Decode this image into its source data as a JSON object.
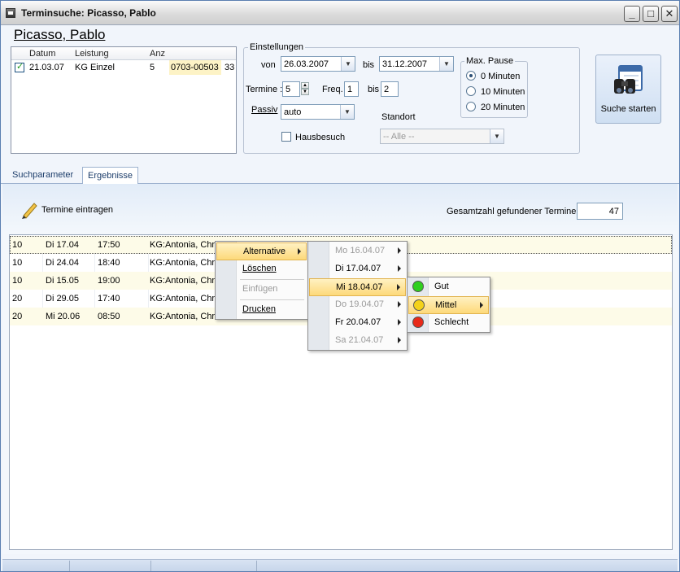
{
  "window": {
    "title": "Terminsuche: Picasso, Pablo"
  },
  "patient_name": "Picasso, Pablo",
  "booking": {
    "headers": [
      "Datum",
      "Leistung",
      "Anz"
    ],
    "rows": [
      {
        "checked": true,
        "datum": "21.03.07",
        "leistung": "KG Einzel",
        "anz": "5",
        "nummer": "0703-00503",
        "extra": "33"
      }
    ]
  },
  "settings": {
    "group_title": "Einstellungen",
    "von_label": "von",
    "von_value": "26.03.2007",
    "bis_label": "bis",
    "bis_value": "31.12.2007",
    "termine_label": "Termine :",
    "termine_value": "5",
    "freq_label": "Freq.",
    "freq_value": "1",
    "freq_bis_label": "bis",
    "freq_bis_value": "2",
    "passiv_label": "Passiv",
    "passiv_value": "auto",
    "standort_label": "Standort",
    "standort_value": "-- Alle --",
    "hausbesuch_label": "Hausbesuch",
    "hausbesuch_checked": false
  },
  "pause": {
    "title": "Max. Pause",
    "options": [
      "0 Minuten",
      "10 Minuten",
      "20 Minuten"
    ],
    "selected": "0 Minuten"
  },
  "search_button": {
    "label": "Suche starten"
  },
  "tabs": [
    {
      "label": "Suchparameter",
      "active": false
    },
    {
      "label": "Ergebnisse",
      "active": true
    }
  ],
  "toolbar": {
    "enter_label": "Termine eintragen",
    "total_label": "Gesamtzahl gefundener Termine",
    "total_value": "47"
  },
  "results": [
    {
      "col1": "10",
      "day": "Di 17.04",
      "time": "17:50",
      "desc": "KG:Antonia, Chri"
    },
    {
      "col1": "10",
      "day": "Di 24.04",
      "time": "18:40",
      "desc": "KG:Antonia, Chri"
    },
    {
      "col1": "10",
      "day": "Di 15.05",
      "time": "19:00",
      "desc": "KG:Antonia, Chri"
    },
    {
      "col1": "20",
      "day": "Di 29.05",
      "time": "17:40",
      "desc": "KG:Antonia, Chri"
    },
    {
      "col1": "20",
      "day": "Mi 20.06",
      "time": "08:50",
      "desc": "KG:Antonia, Chri"
    }
  ],
  "context_menu": {
    "items": [
      {
        "label": "Alternative",
        "enabled": true,
        "submenu": true,
        "highlighted": true
      },
      {
        "label": "Löschen",
        "enabled": true
      },
      {
        "label": "Einfügen",
        "enabled": false
      },
      {
        "label": "Drucken",
        "enabled": true
      }
    ]
  },
  "alternative_menu": {
    "items": [
      {
        "label": "Mo 16.04.07",
        "enabled": false
      },
      {
        "label": "Di 17.04.07",
        "enabled": true
      },
      {
        "label": "Mi 18.04.07",
        "enabled": true,
        "highlighted": true
      },
      {
        "label": "Do 19.04.07",
        "enabled": false
      },
      {
        "label": "Fr 20.04.07",
        "enabled": true
      },
      {
        "label": "Sa 21.04.07",
        "enabled": false
      }
    ]
  },
  "quality_menu": {
    "items": [
      {
        "label": "Gut",
        "color": "#2fcf1f"
      },
      {
        "label": "Mittel",
        "color": "#f4d21a",
        "highlighted": true,
        "submenu": true
      },
      {
        "label": "Schlecht",
        "color": "#e82a1a"
      }
    ]
  }
}
